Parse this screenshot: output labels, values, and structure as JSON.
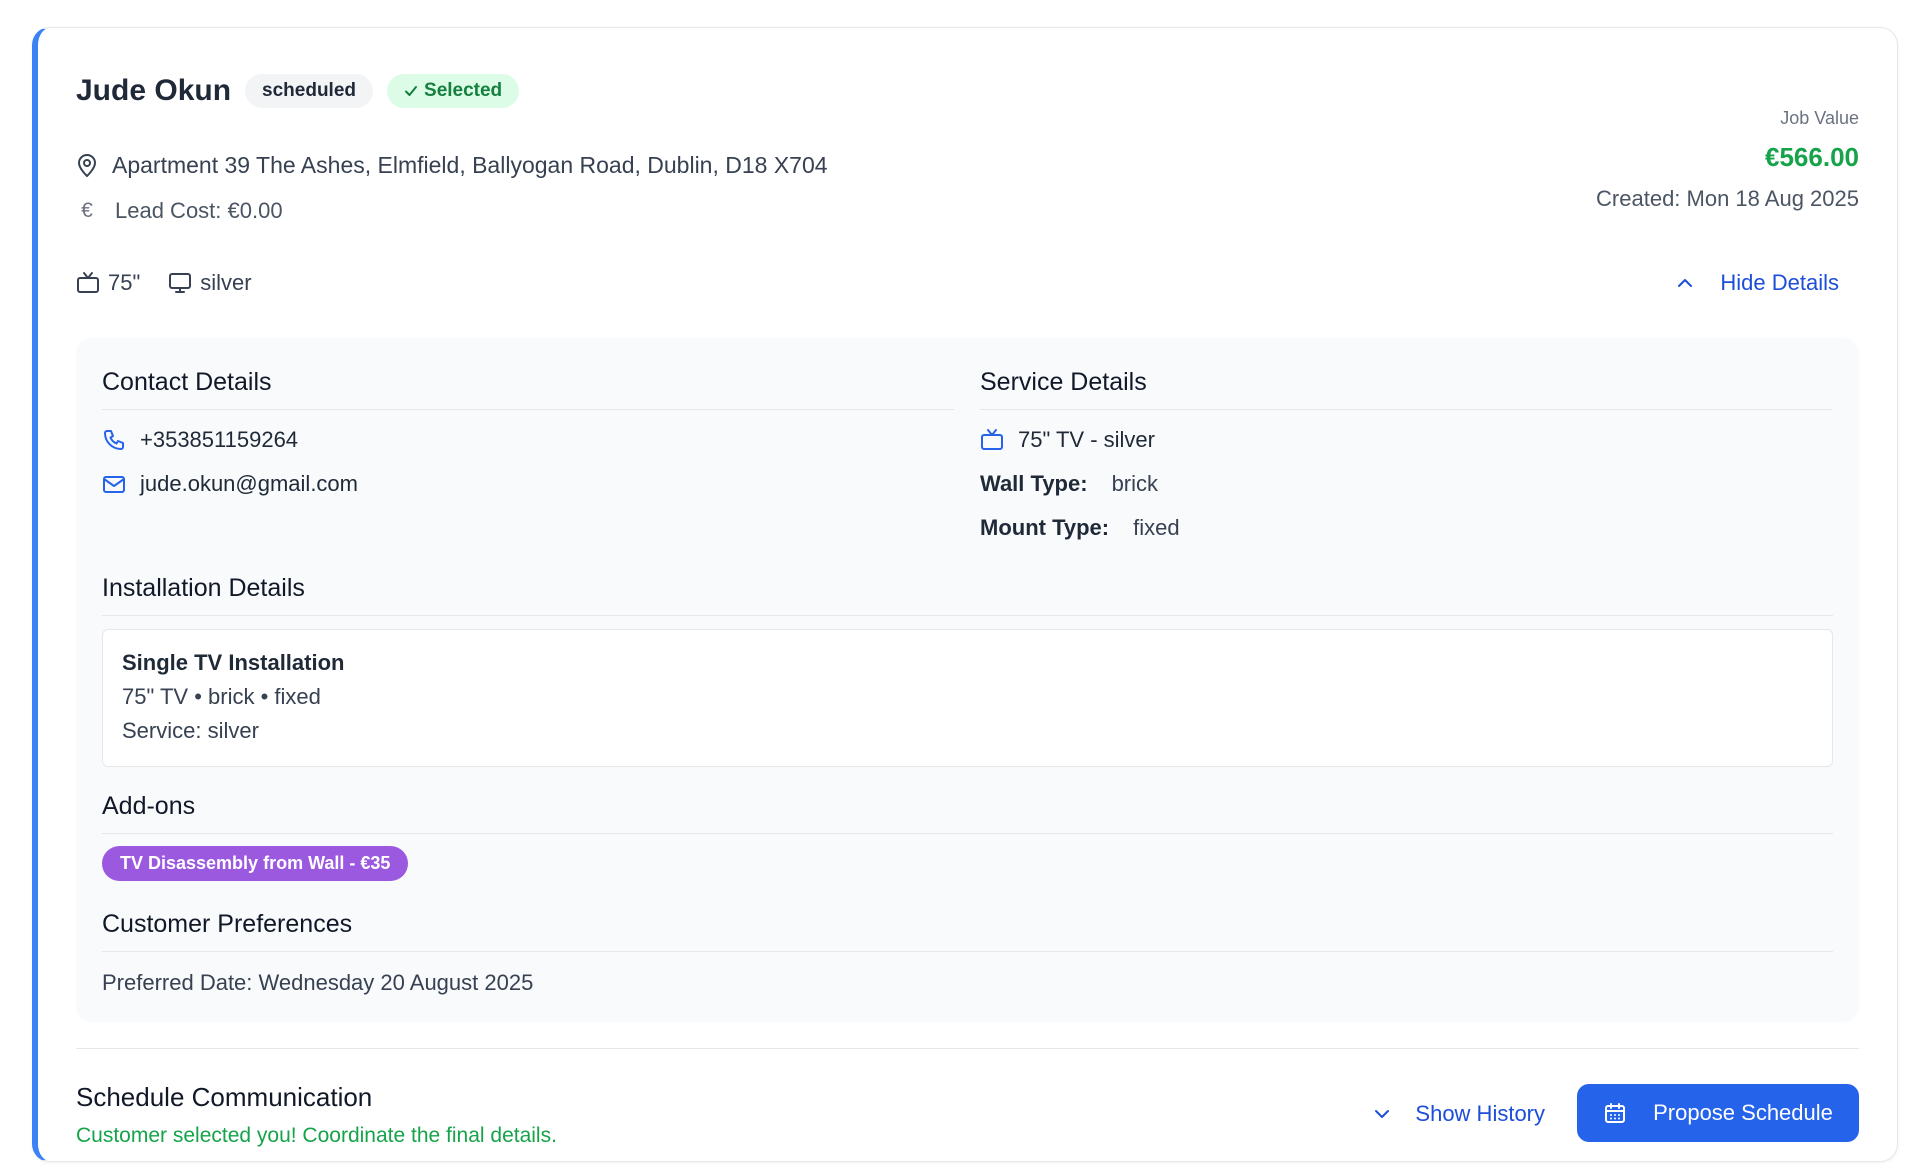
{
  "job": {
    "customer_name": "Jude Okun",
    "status_badge": "scheduled",
    "selected_badge": "Selected",
    "address": "Apartment 39 The Ashes, Elmfield, Ballyogan Road, Dublin, D18 X704",
    "lead_cost_symbol": "€",
    "lead_cost": "Lead Cost: €0.00",
    "job_value_label": "Job Value",
    "job_value": "€566.00",
    "created": "Created: Mon 18 Aug 2025",
    "tv_size": "75\"",
    "tv_service": "silver",
    "hide_details_label": "Hide Details"
  },
  "contact": {
    "title": "Contact Details",
    "phone": "+353851159264",
    "email": "jude.okun@gmail.com"
  },
  "service": {
    "title": "Service Details",
    "tv_line": "75\" TV - silver",
    "wall_type_label": "Wall Type:",
    "wall_type": "brick",
    "mount_type_label": "Mount Type:",
    "mount_type": "fixed"
  },
  "installation": {
    "title": "Installation Details",
    "name": "Single TV Installation",
    "specs": "75\" TV • brick • fixed",
    "service": "Service: silver"
  },
  "addons": {
    "title": "Add-ons",
    "items": [
      "TV Disassembly from Wall - €35"
    ]
  },
  "preferences": {
    "title": "Customer Preferences",
    "preferred_date": "Preferred Date: Wednesday 20 August 2025"
  },
  "schedule": {
    "title": "Schedule Communication",
    "subtitle": "Customer selected you! Coordinate the final details.",
    "show_history_label": "Show History",
    "propose_label": "Propose Schedule"
  },
  "colors": {
    "accent": "#2563eb",
    "success": "#16a34a",
    "addon": "#9b59e0"
  }
}
